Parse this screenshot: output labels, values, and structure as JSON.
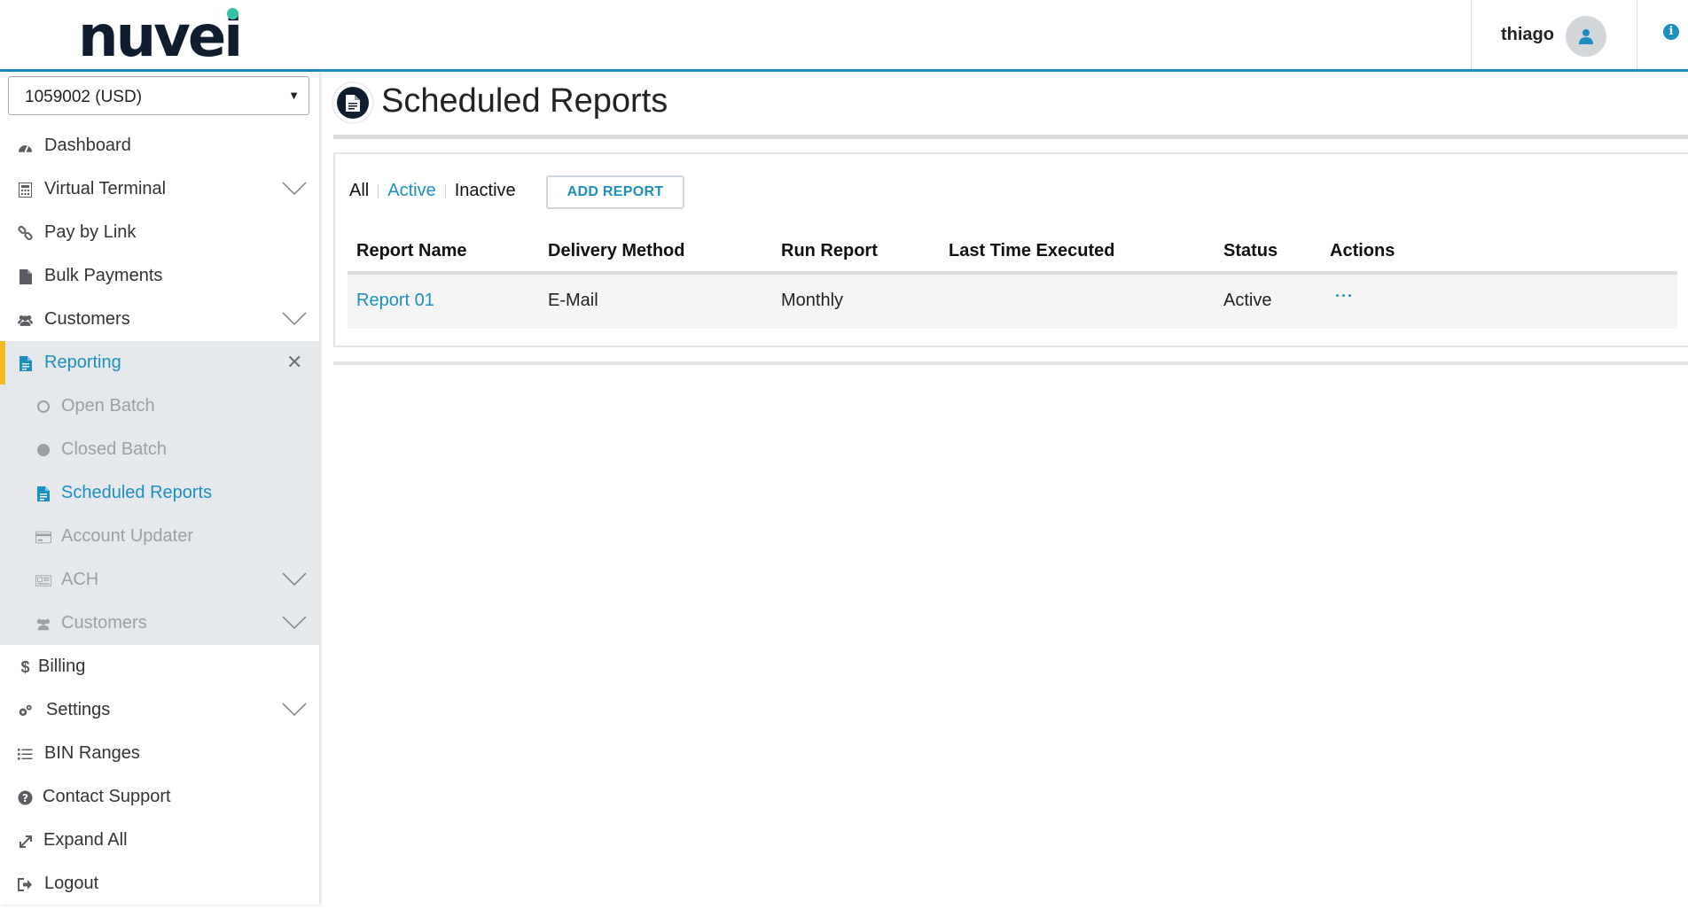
{
  "brand": {
    "logo_text": "nuvei",
    "accent": "#1b8fc0",
    "highlight": "#f5b921",
    "dot_color": "#36c3a6"
  },
  "header": {
    "username": "thiago",
    "avatar_icon": "user-icon",
    "info_icon": "info-icon"
  },
  "sidebar": {
    "account": "1059002 (USD)",
    "items": [
      {
        "label": "Dashboard",
        "icon": "dashboard-icon",
        "expandable": false
      },
      {
        "label": "Virtual Terminal",
        "icon": "calculator-icon",
        "expandable": true
      },
      {
        "label": "Pay by Link",
        "icon": "link-icon",
        "expandable": false
      },
      {
        "label": "Bulk Payments",
        "icon": "file-icon",
        "expandable": false
      },
      {
        "label": "Customers",
        "icon": "users-icon",
        "expandable": true
      },
      {
        "label": "Reporting",
        "icon": "file-text-icon",
        "expanded": true
      },
      {
        "label": "Billing",
        "icon": "dollar-icon",
        "expandable": false
      },
      {
        "label": "Settings",
        "icon": "gears-icon",
        "expandable": true
      },
      {
        "label": "BIN Ranges",
        "icon": "list-icon",
        "expandable": false
      },
      {
        "label": "Contact Support",
        "icon": "question-icon",
        "expandable": false
      },
      {
        "label": "Expand All",
        "icon": "expand-icon",
        "expandable": false
      },
      {
        "label": "Logout",
        "icon": "logout-icon",
        "expandable": false
      }
    ],
    "reporting_sub": [
      {
        "label": "Open Batch",
        "icon": "circle-outline-icon"
      },
      {
        "label": "Closed Batch",
        "icon": "circle-filled-icon"
      },
      {
        "label": "Scheduled Reports",
        "icon": "file-text-icon",
        "current": true
      },
      {
        "label": "Account Updater",
        "icon": "credit-card-icon"
      },
      {
        "label": "ACH",
        "icon": "ach-icon",
        "expandable": true
      },
      {
        "label": "Customers",
        "icon": "users-icon",
        "expandable": true
      }
    ]
  },
  "main": {
    "title": "Scheduled Reports",
    "title_icon": "report-icon",
    "filters": {
      "all": "All",
      "active": "Active",
      "inactive": "Inactive",
      "selected": "Active"
    },
    "add_button": "ADD REPORT",
    "columns": [
      "Report Name",
      "Delivery Method",
      "Run Report",
      "Last Time Executed",
      "Status",
      "Actions"
    ],
    "rows": [
      {
        "name": "Report 01",
        "delivery": "E-Mail",
        "run": "Monthly",
        "last_executed": "",
        "status": "Active",
        "actions": "···"
      }
    ]
  }
}
